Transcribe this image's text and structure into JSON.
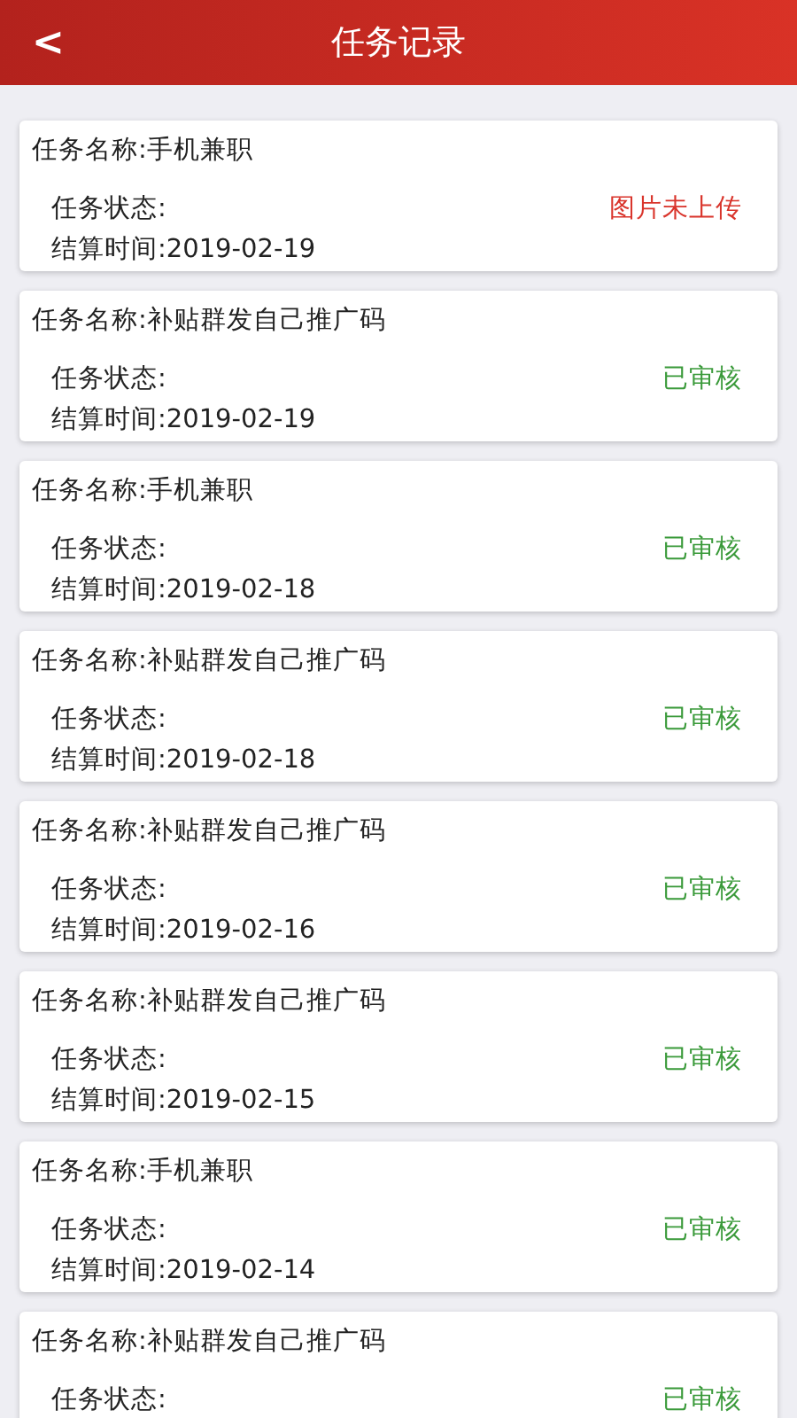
{
  "header": {
    "back": "<",
    "title": "任务记录"
  },
  "records": [
    {
      "name": "任务名称:手机兼职",
      "status_label": "任务状态:",
      "status": "图片未上传",
      "color": "#d9342b",
      "time": "结算时间:2019-02-19"
    },
    {
      "name": "任务名称:补贴群发自己推广码",
      "status_label": "任务状态:",
      "status": "已审核",
      "color": "#3a9a3a",
      "time": "结算时间:2019-02-19"
    },
    {
      "name": "任务名称:手机兼职",
      "status_label": "任务状态:",
      "status": "已审核",
      "color": "#3a9a3a",
      "time": "结算时间:2019-02-18"
    },
    {
      "name": "任务名称:补贴群发自己推广码",
      "status_label": "任务状态:",
      "status": "已审核",
      "color": "#3a9a3a",
      "time": "结算时间:2019-02-18"
    },
    {
      "name": "任务名称:补贴群发自己推广码",
      "status_label": "任务状态:",
      "status": "已审核",
      "color": "#3a9a3a",
      "time": "结算时间:2019-02-16"
    },
    {
      "name": "任务名称:补贴群发自己推广码",
      "status_label": "任务状态:",
      "status": "已审核",
      "color": "#3a9a3a",
      "time": "结算时间:2019-02-15"
    },
    {
      "name": "任务名称:手机兼职",
      "status_label": "任务状态:",
      "status": "已审核",
      "color": "#3a9a3a",
      "time": "结算时间:2019-02-14"
    },
    {
      "name": "任务名称:补贴群发自己推广码",
      "status_label": "任务状态:",
      "status": "已审核",
      "color": "#3a9a3a"
    }
  ]
}
